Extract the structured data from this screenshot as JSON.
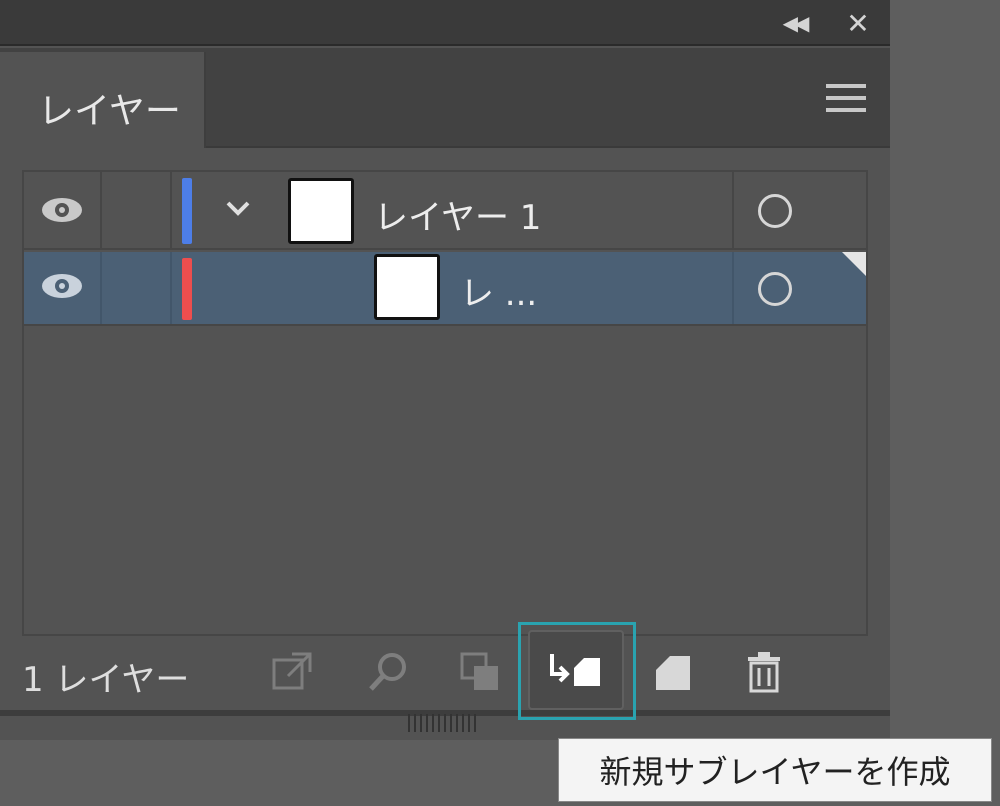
{
  "panel": {
    "tab_label": "レイヤー",
    "collapse_icon": "double-chevron-left-icon",
    "close_icon": "close-icon",
    "menu_icon": "hamburger-menu-icon"
  },
  "layers": [
    {
      "name": "レイヤー 1",
      "visible": true,
      "color": "#4d7ee8",
      "expanded": true,
      "selected": false
    },
    {
      "name": "レ ...",
      "visible": true,
      "color": "#ee4e4e",
      "expanded": false,
      "selected": true
    }
  ],
  "footer": {
    "layer_count": "1 レイヤー",
    "buttons": [
      {
        "icon": "export-icon",
        "enabled": false
      },
      {
        "icon": "search-icon",
        "enabled": false
      },
      {
        "icon": "clipping-mask-icon",
        "enabled": false
      },
      {
        "icon": "new-sublayer-icon",
        "enabled": true
      },
      {
        "icon": "new-layer-icon",
        "enabled": true
      },
      {
        "icon": "trash-icon",
        "enabled": true
      }
    ]
  },
  "tooltip": {
    "text": "新規サブレイヤーを作成"
  },
  "colors": {
    "selection": "#4b6075",
    "highlight": "#2aa3b0"
  }
}
